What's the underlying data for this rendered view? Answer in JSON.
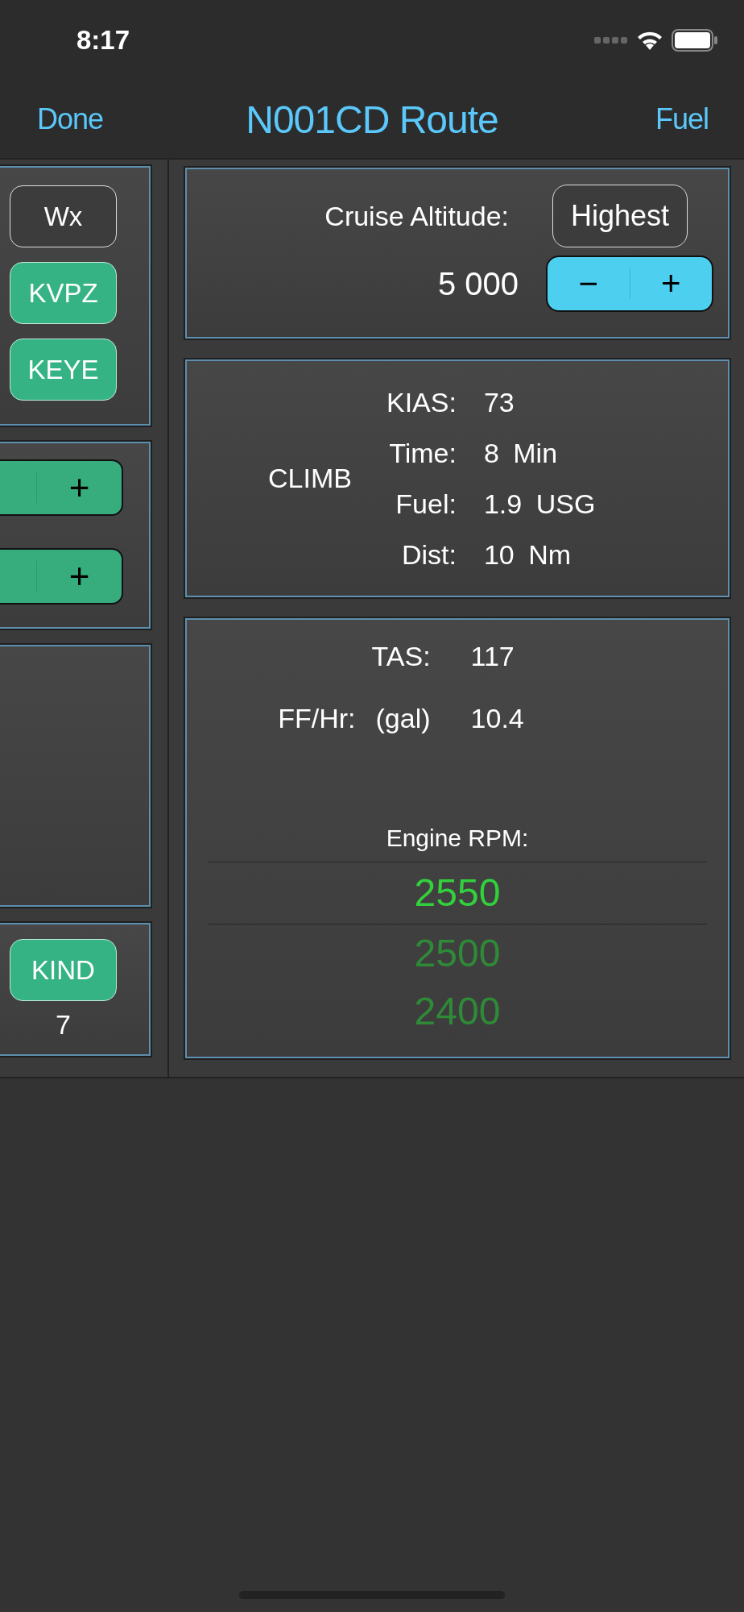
{
  "status_bar": {
    "time": "8:17"
  },
  "nav": {
    "left": "Done",
    "title": "N001CD Route",
    "right": "Fuel"
  },
  "left_column": {
    "airport_buttons": [
      {
        "label": "Wx",
        "kind": "outline"
      },
      {
        "label": "KVPZ",
        "kind": "filled"
      },
      {
        "label": "KEYE",
        "kind": "filled"
      }
    ],
    "steppers": [
      {
        "plus": "+"
      },
      {
        "plus": "+"
      }
    ],
    "destination": {
      "button": "KIND",
      "value": "7"
    }
  },
  "cruise_altitude": {
    "label": "Cruise Altitude:",
    "button": "Highest",
    "value": "5 000",
    "minus": "−",
    "plus": "+"
  },
  "climb": {
    "title": "CLIMB",
    "rows": [
      {
        "label": "KIAS:",
        "value": "73"
      },
      {
        "label": "Time:",
        "value": "8 Min"
      },
      {
        "label": "Fuel:",
        "value": "1.9 USG"
      },
      {
        "label": "Dist:",
        "value": "10 Nm"
      }
    ]
  },
  "cruise": {
    "rows": [
      {
        "label": "TAS:",
        "value": "117"
      },
      {
        "label": "FF/Hr:",
        "unit": "(gal)",
        "value": "10.4"
      }
    ],
    "rpm_label": "Engine RPM:",
    "rpm_options": [
      {
        "label": "2550",
        "selected": true
      },
      {
        "label": "2500",
        "selected": false
      },
      {
        "label": "2400",
        "selected": false
      }
    ]
  }
}
